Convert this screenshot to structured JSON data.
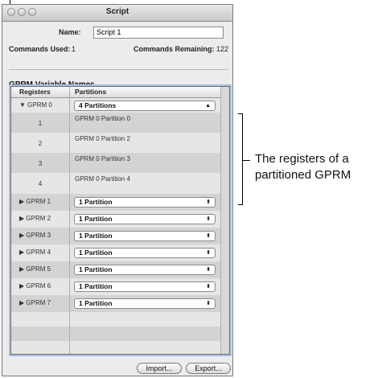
{
  "window": {
    "title": "Script"
  },
  "header": {
    "name_label": "Name:",
    "name_value": "Script 1",
    "commands_used_label": "Commands Used:",
    "commands_used_value": "1",
    "commands_remaining_label": "Commands Remaining:",
    "commands_remaining_value": "122"
  },
  "section": {
    "title": "GPRM Variable Names"
  },
  "table": {
    "columns": [
      "Registers",
      "Partitions"
    ],
    "expanded": {
      "register": "GPRM 0",
      "partitions_value": "4 Partitions",
      "children": [
        {
          "register": "1",
          "label": "GPRM 0 Partition 0"
        },
        {
          "register": "2",
          "label": "GPRM 0 Partition 2"
        },
        {
          "register": "3",
          "label": "GPRM 0 Partition 3"
        },
        {
          "register": "4",
          "label": "GPRM 0 Partition 4"
        }
      ]
    },
    "collapsed": [
      {
        "register": "GPRM 1",
        "partitions_value": "1 Partition"
      },
      {
        "register": "GPRM 2",
        "partitions_value": "1 Partition"
      },
      {
        "register": "GPRM 3",
        "partitions_value": "1 Partition"
      },
      {
        "register": "GPRM 4",
        "partitions_value": "1 Partition"
      },
      {
        "register": "GPRM 5",
        "partitions_value": "1 Partition"
      },
      {
        "register": "GPRM 6",
        "partitions_value": "1 Partition"
      },
      {
        "register": "GPRM 7",
        "partitions_value": "1 Partition"
      }
    ]
  },
  "buttons": {
    "import": "Import...",
    "export": "Export..."
  },
  "callout": {
    "line1": "The registers of a",
    "line2": "partitioned GPRM"
  },
  "icons": {
    "expanded": "disclosure-triangle-down",
    "collapsed": "disclosure-triangle-right",
    "popup": "updown-arrows"
  }
}
